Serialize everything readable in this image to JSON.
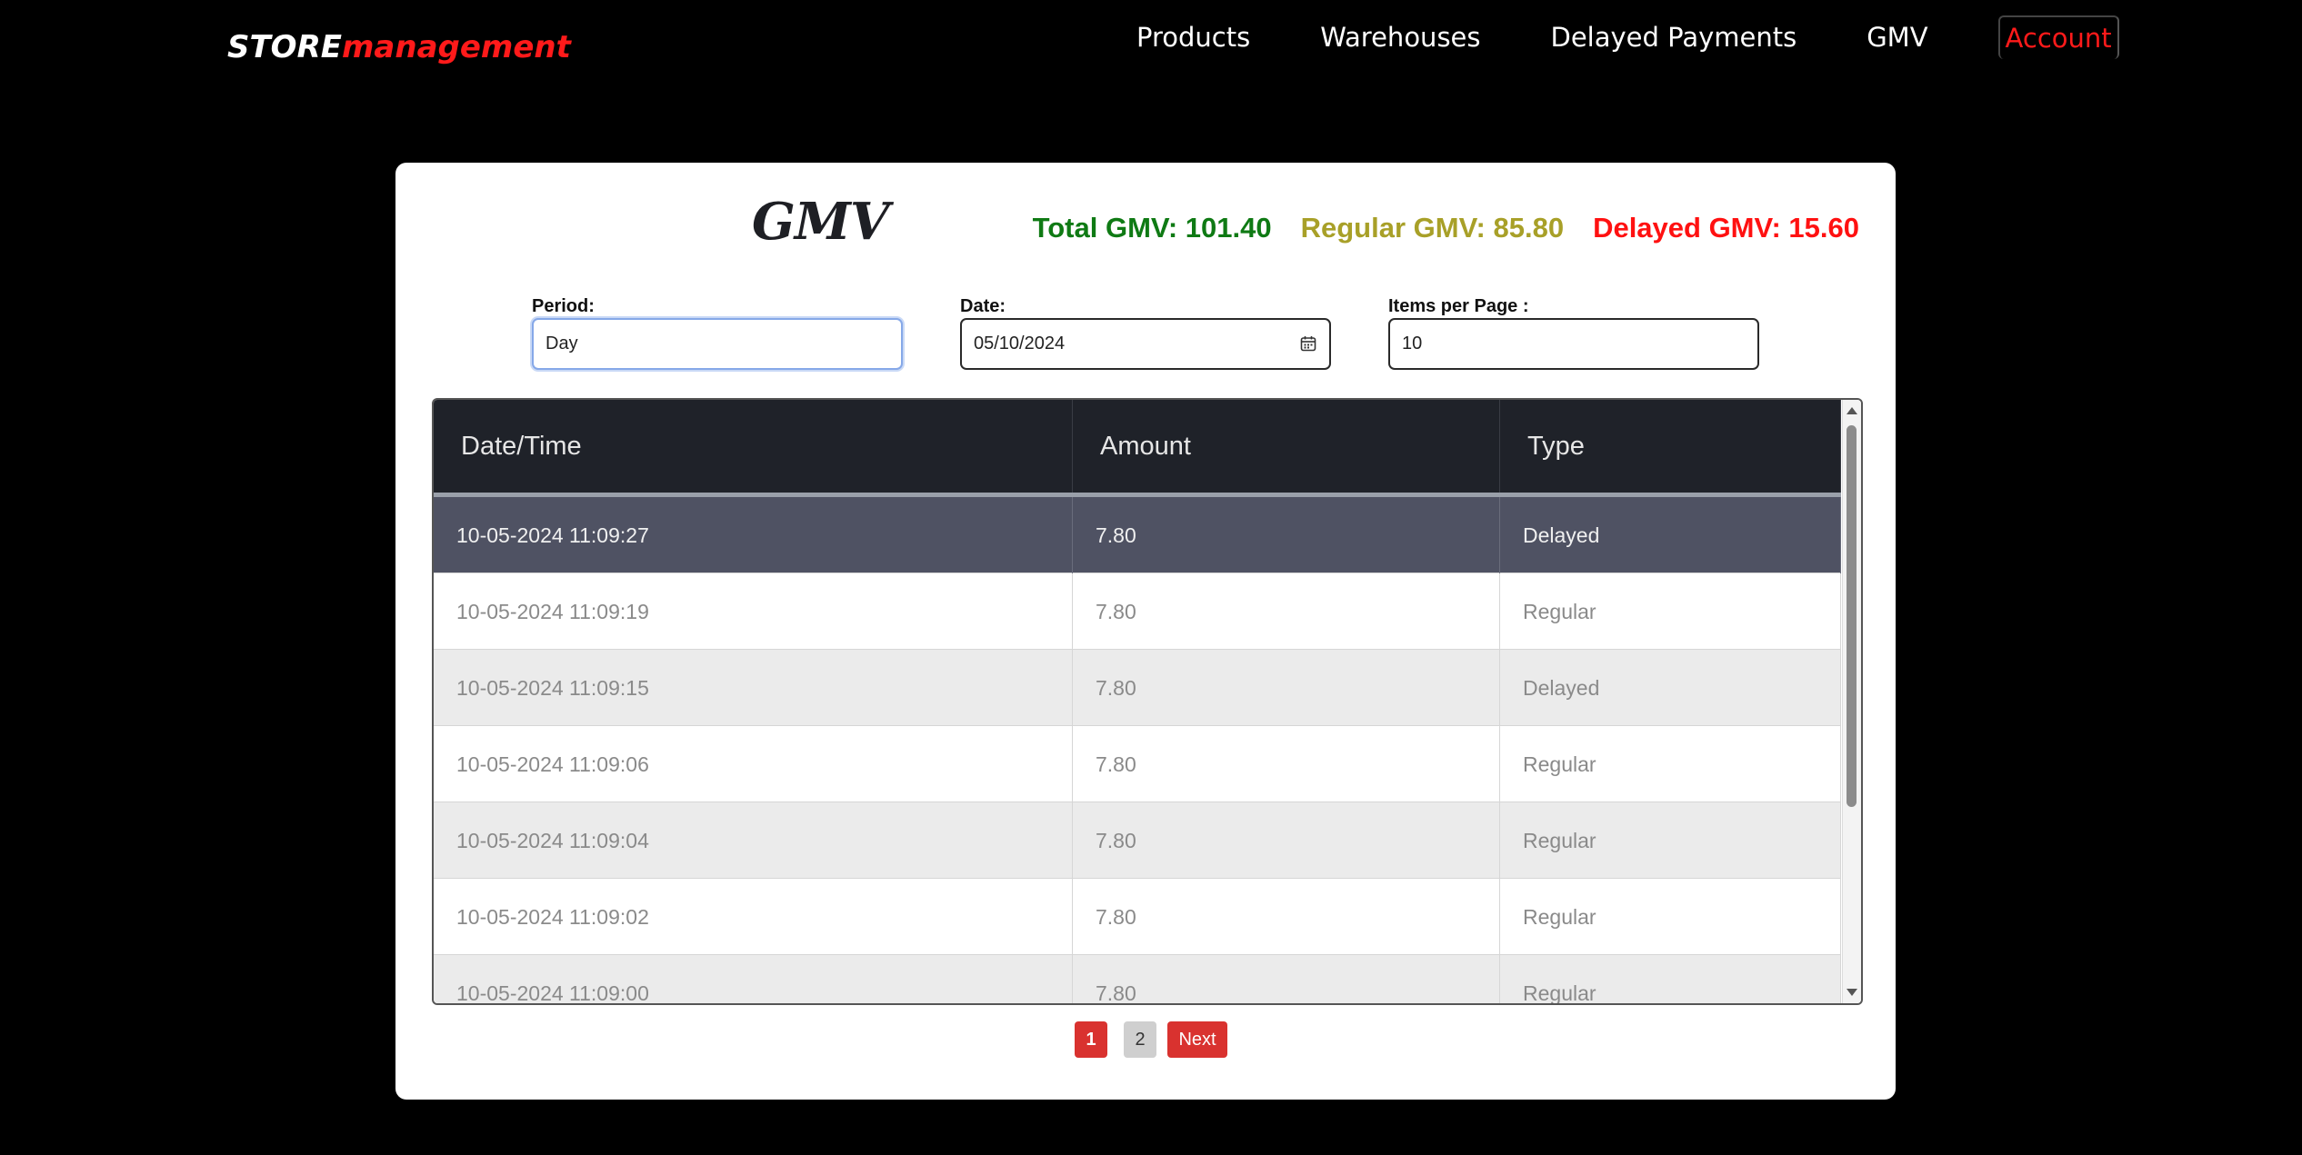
{
  "brand": {
    "part1": "STORE",
    "part2": "management"
  },
  "nav": {
    "items": [
      "Products",
      "Warehouses",
      "Delayed Payments",
      "GMV"
    ],
    "account": "Account"
  },
  "page": {
    "title": "GMV",
    "totals": {
      "total": "Total GMV: 101.40",
      "regular": "Regular GMV: 85.80",
      "delayed": "Delayed GMV: 15.60"
    }
  },
  "filters": {
    "period": {
      "label": "Period:",
      "value": "Day"
    },
    "date": {
      "label": "Date:",
      "value": "05/10/2024"
    },
    "items_per_page": {
      "label": "Items per Page :",
      "value": "10"
    }
  },
  "table": {
    "headers": [
      "Date/Time",
      "Amount",
      "Type"
    ],
    "rows": [
      [
        "10-05-2024 11:09:27",
        "7.80",
        "Delayed"
      ],
      [
        "10-05-2024 11:09:19",
        "7.80",
        "Regular"
      ],
      [
        "10-05-2024 11:09:15",
        "7.80",
        "Delayed"
      ],
      [
        "10-05-2024 11:09:06",
        "7.80",
        "Regular"
      ],
      [
        "10-05-2024 11:09:04",
        "7.80",
        "Regular"
      ],
      [
        "10-05-2024 11:09:02",
        "7.80",
        "Regular"
      ],
      [
        "10-05-2024 11:09:00",
        "7.80",
        "Regular"
      ]
    ]
  },
  "pagination": {
    "current": "1",
    "other": "2",
    "next": "Next"
  },
  "colors": {
    "accent_red": "#d9322f",
    "total_green": "#0f7a14",
    "regular_olive": "#a8a028",
    "delayed_red": "#ff1111",
    "header_dark": "#1f2229"
  }
}
